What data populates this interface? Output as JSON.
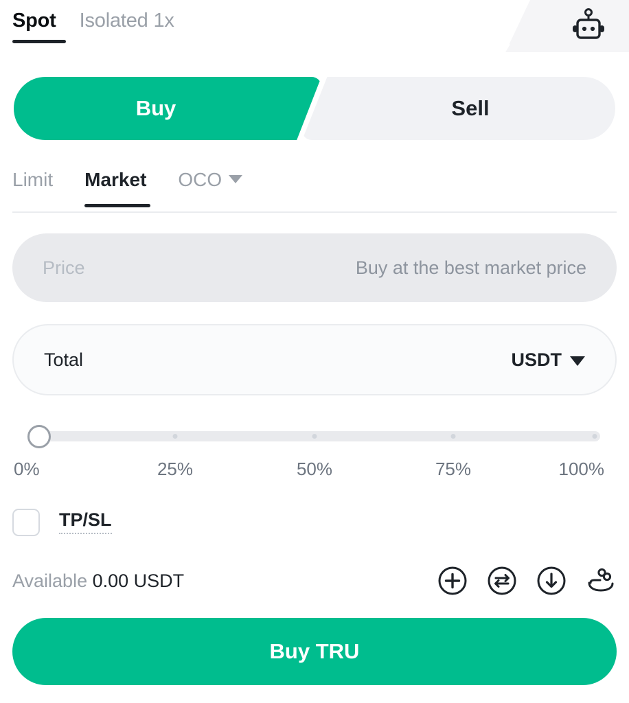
{
  "header": {
    "tabs": [
      {
        "label": "Spot",
        "active": true
      },
      {
        "label": "Isolated 1x",
        "active": false
      }
    ],
    "bot_icon": "robot-icon"
  },
  "side_toggle": {
    "buy_label": "Buy",
    "sell_label": "Sell",
    "selected": "Buy",
    "buy_color": "#00bd8e",
    "sell_bg": "#f1f2f5"
  },
  "order_types": [
    {
      "label": "Limit",
      "active": false
    },
    {
      "label": "Market",
      "active": true
    },
    {
      "label": "OCO",
      "active": false,
      "caret": "chevron-down-icon"
    }
  ],
  "price_field": {
    "label": "Price",
    "value": "Buy at the best market price",
    "disabled": true
  },
  "total_field": {
    "label": "Total",
    "currency": "USDT",
    "caret": "chevron-down-icon",
    "value": ""
  },
  "slider": {
    "value_percent": 0,
    "labels": [
      "0%",
      "25%",
      "50%",
      "75%",
      "100%"
    ],
    "positions": [
      0,
      25,
      50,
      75,
      100
    ]
  },
  "tpsl": {
    "label": "TP/SL",
    "checked": false
  },
  "available": {
    "label": "Available",
    "value": "0.00 USDT"
  },
  "quick_actions": [
    {
      "name": "add-funds-icon",
      "title": "Add"
    },
    {
      "name": "convert-icon",
      "title": "Convert"
    },
    {
      "name": "deposit-icon",
      "title": "Deposit"
    },
    {
      "name": "earn-icon",
      "title": "Earn"
    }
  ],
  "submit": {
    "label": "Buy TRU"
  }
}
